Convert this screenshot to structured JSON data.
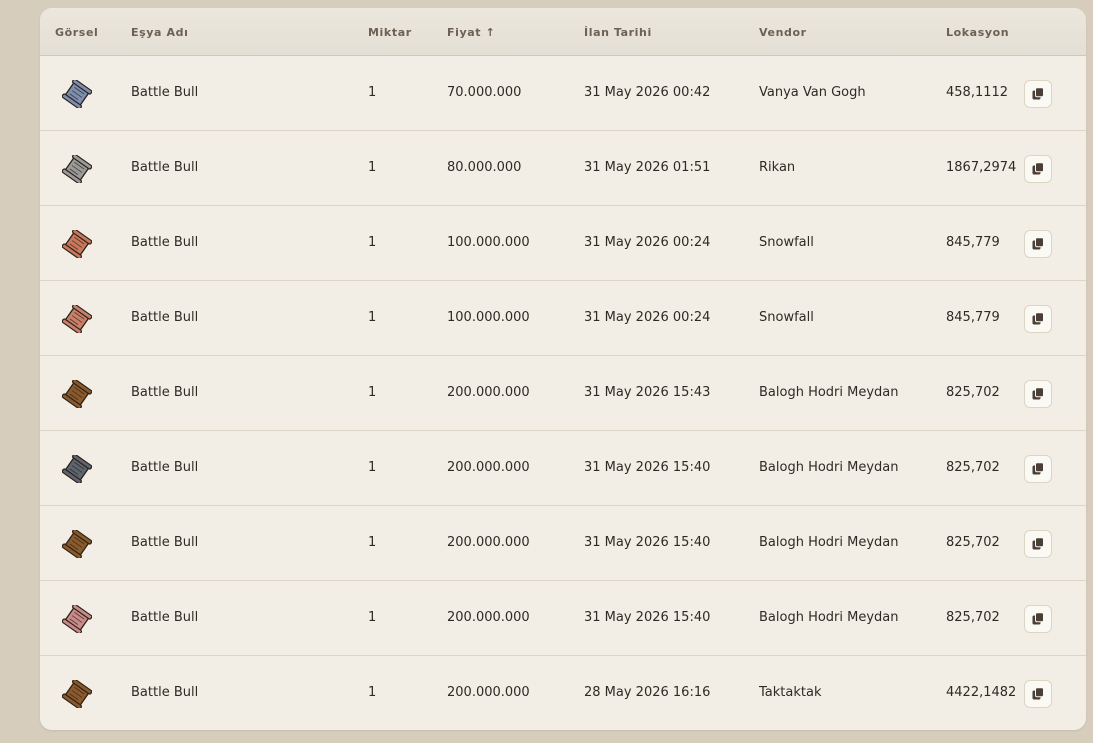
{
  "table": {
    "headers": {
      "image": "Görsel",
      "name": "Eşya Adı",
      "quantity": "Miktar",
      "price": "Fiyat ↑",
      "date": "İlan Tarihi",
      "vendor": "Vendor",
      "location": "Lokasyon"
    },
    "rows": [
      {
        "name": "Battle Bull",
        "quantity": "1",
        "price": "70.000.000",
        "date": "31 May 2026 00:42",
        "vendor": "Vanya Van Gogh",
        "location": "458,1112",
        "icon_color": "#7d8fb0"
      },
      {
        "name": "Battle Bull",
        "quantity": "1",
        "price": "80.000.000",
        "date": "31 May 2026 01:51",
        "vendor": "Rikan",
        "location": "1867,2974",
        "icon_color": "#9a9a9a"
      },
      {
        "name": "Battle Bull",
        "quantity": "1",
        "price": "100.000.000",
        "date": "31 May 2026 00:24",
        "vendor": "Snowfall",
        "location": "845,779",
        "icon_color": "#c9785e"
      },
      {
        "name": "Battle Bull",
        "quantity": "1",
        "price": "100.000.000",
        "date": "31 May 2026 00:24",
        "vendor": "Snowfall",
        "location": "845,779",
        "icon_color": "#c9806a"
      },
      {
        "name": "Battle Bull",
        "quantity": "1",
        "price": "200.000.000",
        "date": "31 May 2026 15:43",
        "vendor": "Balogh Hodri Meydan",
        "location": "825,702",
        "icon_color": "#8a5a2c"
      },
      {
        "name": "Battle Bull",
        "quantity": "1",
        "price": "200.000.000",
        "date": "31 May 2026 15:40",
        "vendor": "Balogh Hodri Meydan",
        "location": "825,702",
        "icon_color": "#5e6470"
      },
      {
        "name": "Battle Bull",
        "quantity": "1",
        "price": "200.000.000",
        "date": "31 May 2026 15:40",
        "vendor": "Balogh Hodri Meydan",
        "location": "825,702",
        "icon_color": "#8a5a2c"
      },
      {
        "name": "Battle Bull",
        "quantity": "1",
        "price": "200.000.000",
        "date": "31 May 2026 15:40",
        "vendor": "Balogh Hodri Meydan",
        "location": "825,702",
        "icon_color": "#c98a8a"
      },
      {
        "name": "Battle Bull",
        "quantity": "1",
        "price": "200.000.000",
        "date": "28 May 2026 16:16",
        "vendor": "Taktaktak",
        "location": "4422,1482",
        "icon_color": "#8a5a2c"
      }
    ]
  },
  "icons": {
    "item": "scroll-icon",
    "copy": "copy-icon"
  }
}
